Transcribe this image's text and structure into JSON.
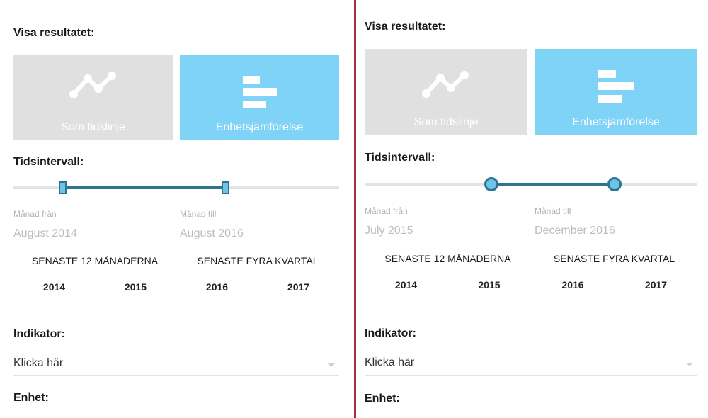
{
  "panels": [
    {
      "show_results_label": "Visa resultatet:",
      "timeline_button": {
        "label": "Som tidslinje",
        "icon": "line-chart-icon",
        "selected": false
      },
      "comparison_button": {
        "label": "Enhetsjämförelse",
        "icon": "horizontal-bars-icon",
        "selected": true
      },
      "time_interval_label": "Tidsintervall:",
      "slider": {
        "start": 0.15,
        "end": 0.65,
        "handle_style": "square"
      },
      "month_from": {
        "label": "Månad från",
        "value": "August 2014"
      },
      "month_to": {
        "label": "Månad till",
        "value": "August 2016"
      },
      "presets": [
        "SENASTE 12 MÅNADERNA",
        "SENASTE FYRA KVARTAL"
      ],
      "years": [
        "2014",
        "2015",
        "2016",
        "2017"
      ],
      "indicator_label": "Indikator:",
      "indicator_select": {
        "value": "Klicka här"
      },
      "unit_label": "Enhet:"
    },
    {
      "show_results_label": "Visa resultatet:",
      "timeline_button": {
        "label": "Som tidslinje",
        "icon": "line-chart-icon",
        "selected": false
      },
      "comparison_button": {
        "label": "Enhetsjämförelse",
        "icon": "horizontal-bars-icon",
        "selected": true
      },
      "time_interval_label": "Tidsintervall:",
      "slider": {
        "start": 0.38,
        "end": 0.75,
        "handle_style": "round"
      },
      "month_from": {
        "label": "Månad från",
        "value": "July 2015"
      },
      "month_to": {
        "label": "Månad till",
        "value": "December 2016"
      },
      "presets": [
        "SENASTE 12 MÅNADERNA",
        "SENASTE FYRA KVARTAL"
      ],
      "years": [
        "2014",
        "2015",
        "2016",
        "2017"
      ],
      "indicator_label": "Indikator:",
      "indicator_select": {
        "value": "Klicka här"
      },
      "unit_label": "Enhet:"
    }
  ],
  "colors": {
    "selected_button": "#7ed3f7",
    "unselected_button": "#e0e0e0",
    "slider_range": "#2e7590",
    "slider_handle": "#6cc4e8",
    "divider": "#a33044"
  }
}
